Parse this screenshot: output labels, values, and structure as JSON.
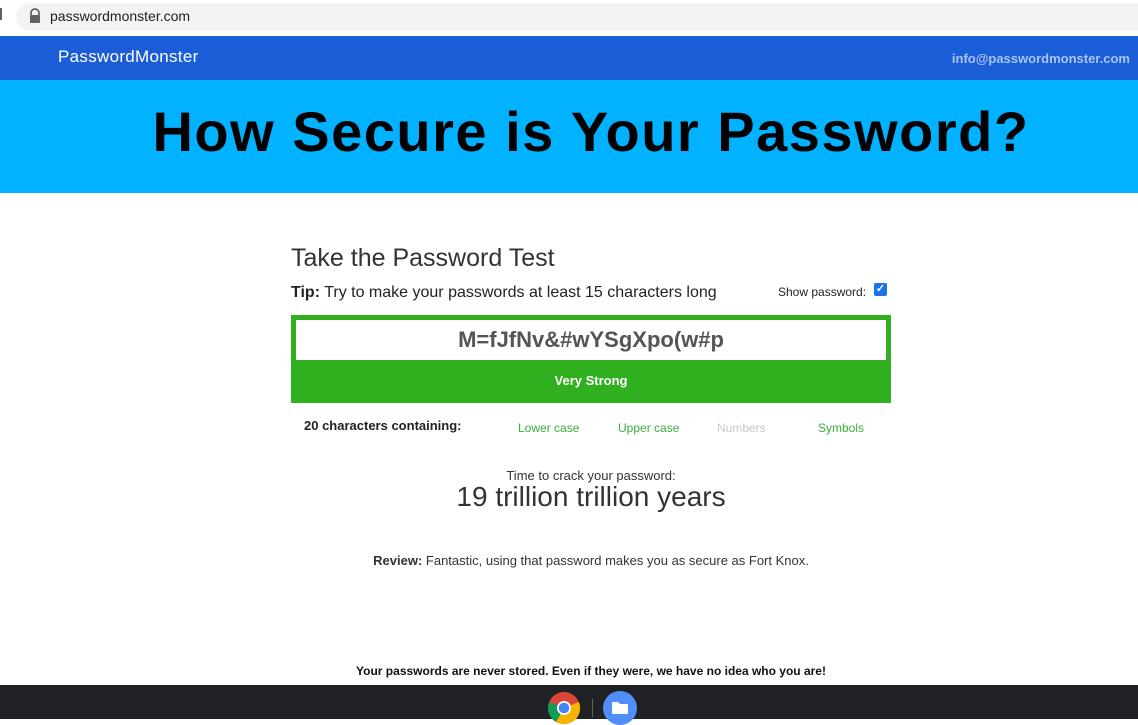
{
  "browser": {
    "url": "passwordmonster.com"
  },
  "header": {
    "logo": "PasswordMonster",
    "email": "info@passwordmonster.com"
  },
  "banner": {
    "headline": "How Secure is Your Password?"
  },
  "test": {
    "title": "Take the Password Test",
    "tip_label": "Tip:",
    "tip_text": " Try to make your passwords at least 15 characters long",
    "show_password_label": "Show password:",
    "show_password_checked": true,
    "password_value": "M=fJfNv&#wYSgXpo(w#p",
    "strength": "Very Strong",
    "char_count_text": "20 characters containing:",
    "char_types": {
      "lower": "Lower case",
      "upper": "Upper case",
      "numbers": "Numbers",
      "symbols": "Symbols"
    },
    "crack_label": "Time to crack your password:",
    "crack_time": "19 trillion trillion years",
    "review_label": "Review:",
    "review_text": " Fantastic, using that password makes you as secure as Fort Knox."
  },
  "footer": {
    "note": "Your passwords are never stored. Even if they were, we have no idea who you are!"
  },
  "colors": {
    "header_blue": "#1a5dd6",
    "banner_cyan": "#00b2ff",
    "strength_green": "#30b01f",
    "active_type": "#3cae3c",
    "inactive_type": "#c8c8c8"
  },
  "taskbar": {
    "icons": [
      "chrome-icon",
      "files-icon"
    ]
  }
}
